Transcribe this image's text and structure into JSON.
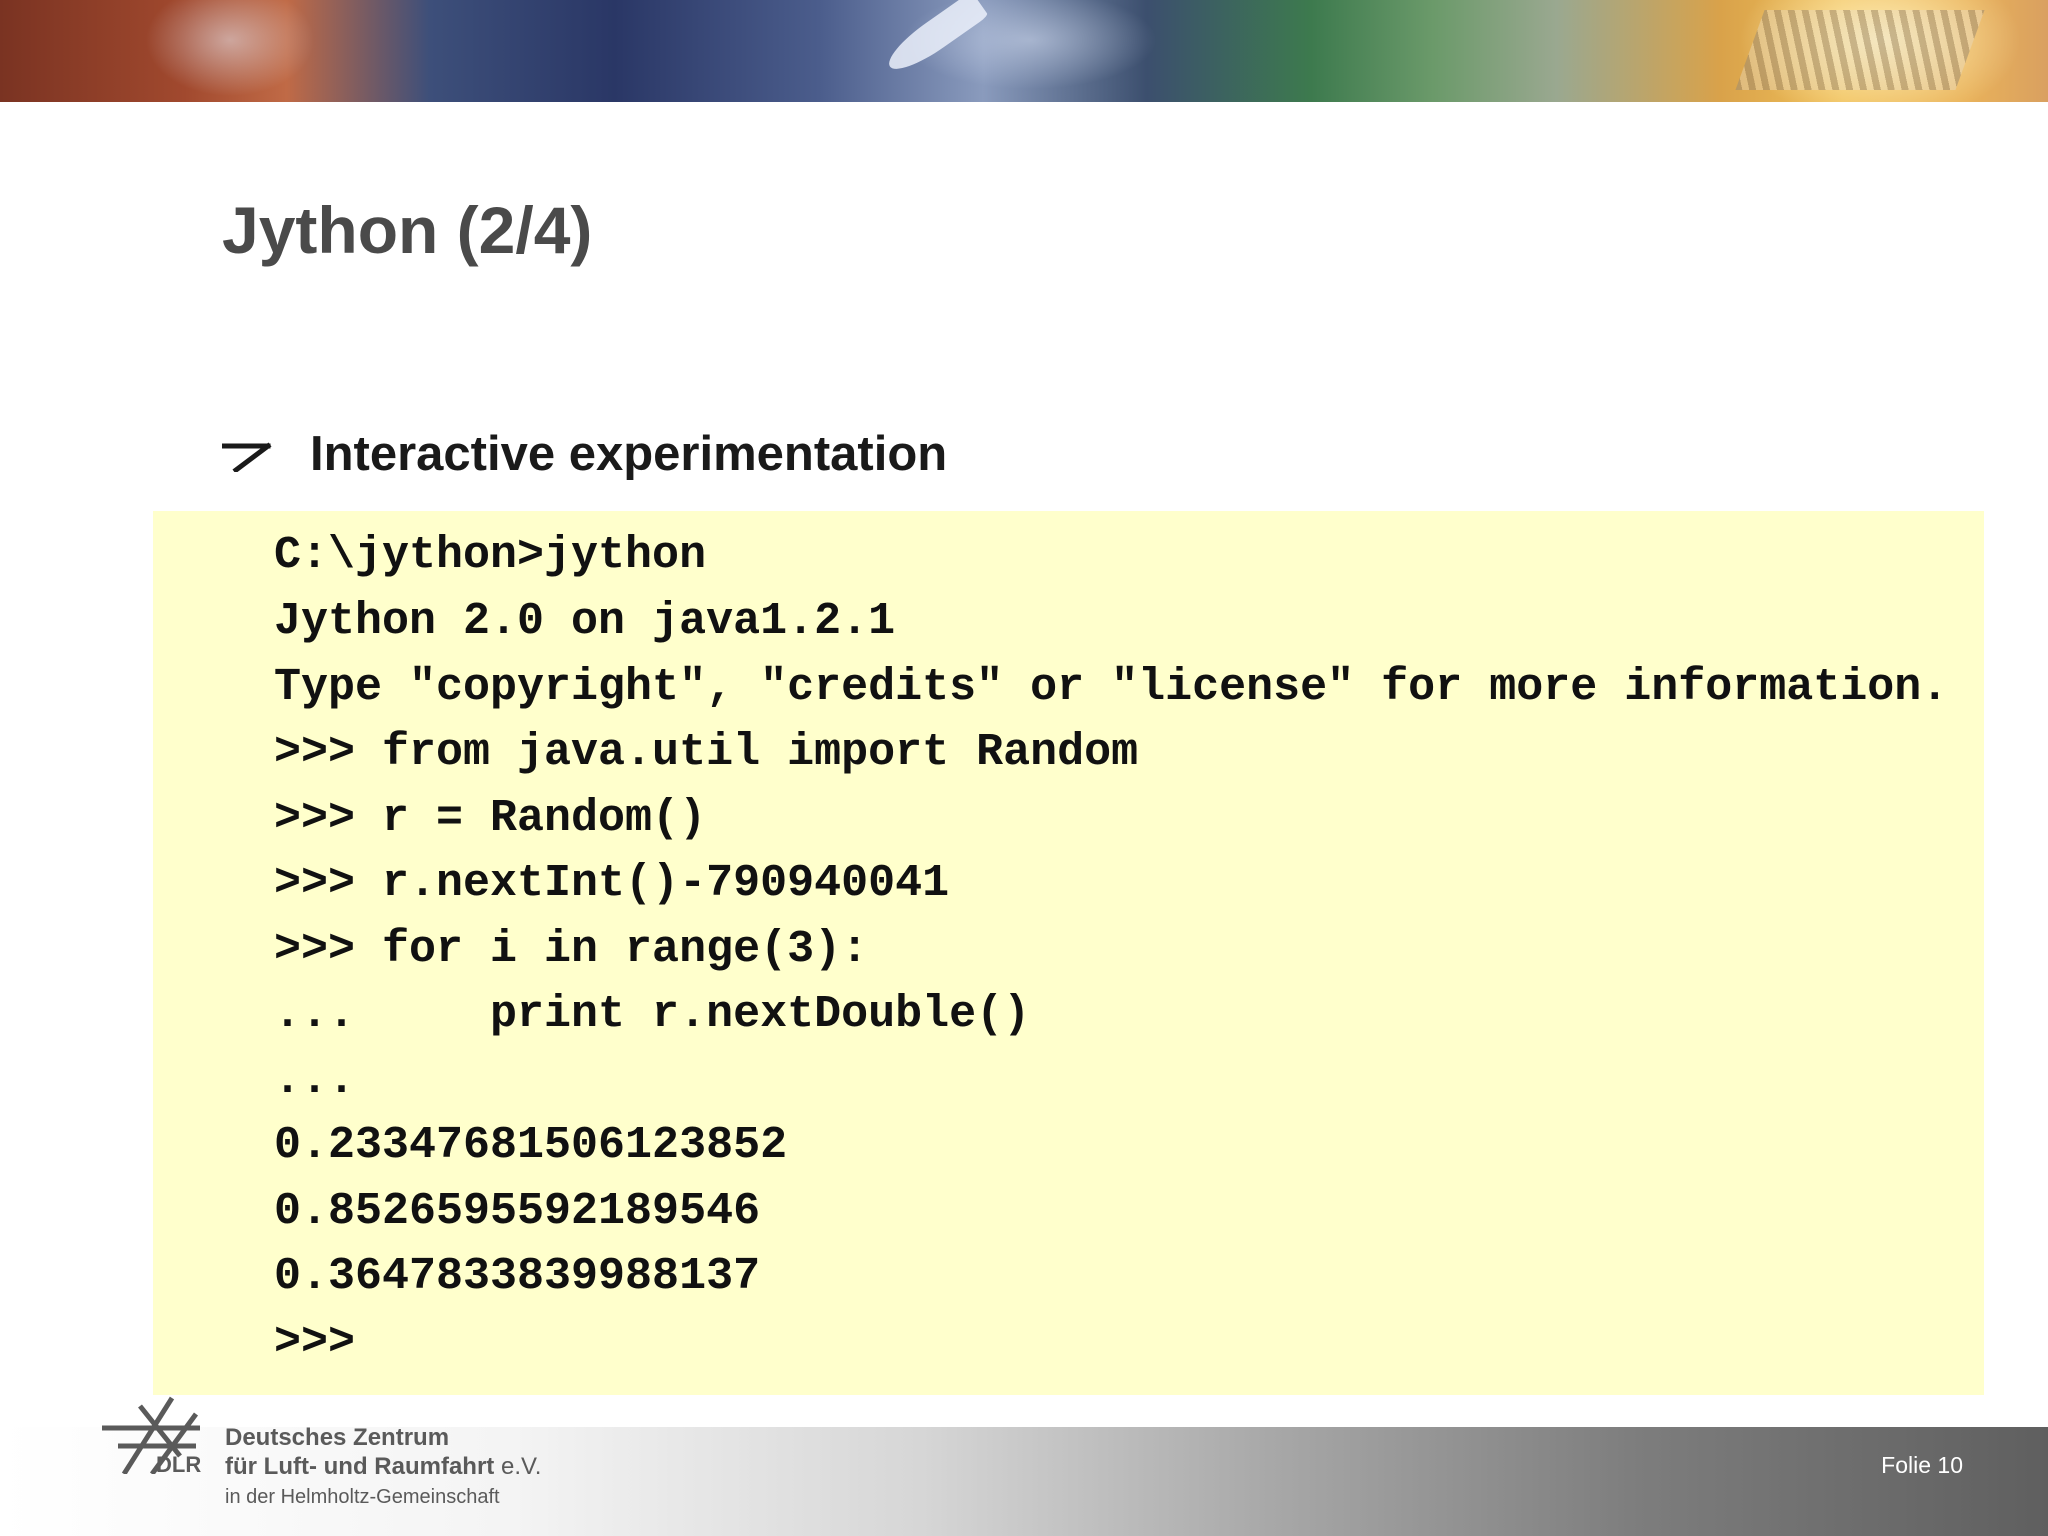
{
  "slide": {
    "title": "Jython (2/4)",
    "bullet": "Interactive experimentation"
  },
  "code": {
    "lines": [
      "C:\\jython>jython",
      "Jython 2.0 on java1.2.1",
      "Type \"copyright\", \"credits\" or \"license\" for more information.",
      ">>> from java.util import Random",
      ">>> r = Random()",
      ">>> r.nextInt()-790940041",
      ">>> for i in range(3):",
      "...     print r.nextDouble()",
      "...",
      "0.23347681506123852",
      "0.8526595592189546",
      "0.3647833839988137",
      ">>>"
    ]
  },
  "footer": {
    "logo_text": "DLR",
    "org_line1": "Deutsches Zentrum",
    "org_line2": "für Luft- und Raumfahrt",
    "org_line2_suffix": "e.V.",
    "org_line3": "in der Helmholtz-Gemeinschaft",
    "slide_number": "Folie 10"
  },
  "colors": {
    "code_background": "#ffffcc",
    "title_color": "#4a4a4a"
  }
}
